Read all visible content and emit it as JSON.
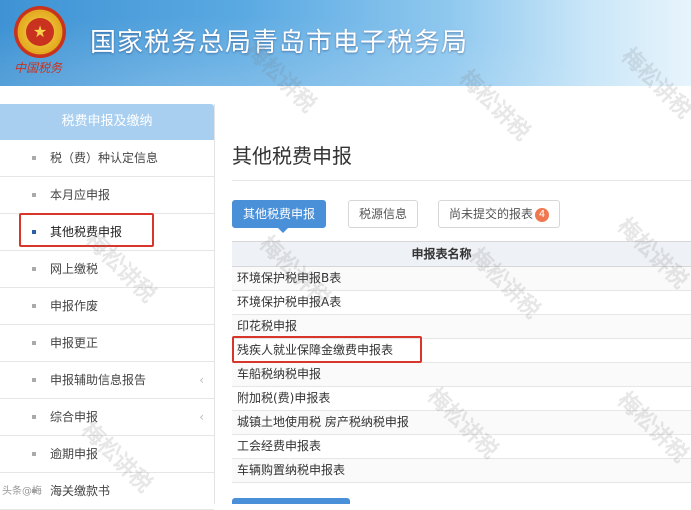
{
  "banner": {
    "title": "国家税务总局青岛市电子税务局",
    "emblem_text": "中国税务"
  },
  "sidebar": {
    "header": "税费申报及缴纳",
    "items": [
      {
        "label": "税（费）种认定信息"
      },
      {
        "label": "本月应申报"
      },
      {
        "label": "其他税费申报"
      },
      {
        "label": "网上缴税"
      },
      {
        "label": "申报作废"
      },
      {
        "label": "申报更正"
      },
      {
        "label": "申报辅助信息报告"
      },
      {
        "label": "综合申报"
      },
      {
        "label": "逾期申报"
      },
      {
        "label": "海关缴款书"
      }
    ]
  },
  "main": {
    "title": "其他税费申报",
    "tabs": [
      {
        "label": "其他税费申报"
      },
      {
        "label": "税源信息"
      },
      {
        "label": "尚未提交的报表",
        "badge": "4"
      }
    ],
    "table": {
      "header": "申报表名称",
      "rows": [
        "环境保护税申报B表",
        "环境保护税申报A表",
        "印花税申报",
        "残疾人就业保障金缴费申报表",
        "车船税纳税申报",
        "附加税(费)申报表",
        "城镇土地使用税 房产税纳税申报",
        "工会经费申报表",
        "车辆购置纳税申报表"
      ]
    }
  },
  "watermark": "梅松讲税",
  "footer_logo": "头条@梅"
}
